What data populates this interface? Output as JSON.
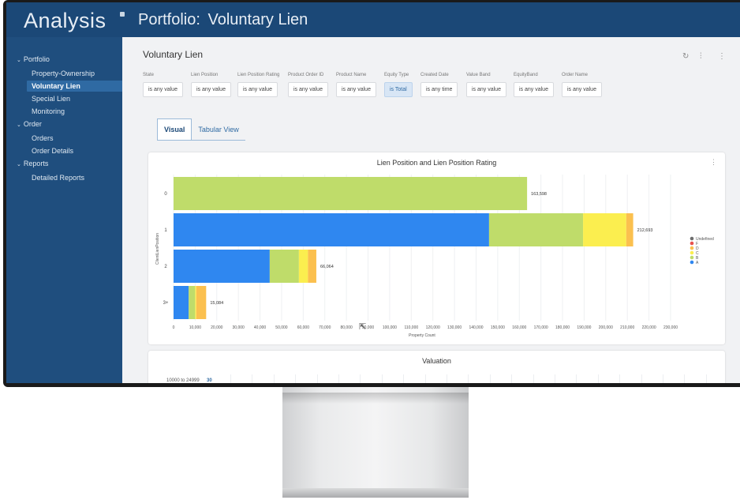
{
  "app": {
    "title": "Analysis"
  },
  "page": {
    "title_prefix": "Portfolio:",
    "title_name": "Voluntary Lien"
  },
  "sidebar": {
    "sections": [
      {
        "label": "Portfolio",
        "items": [
          {
            "label": "Property-Ownership",
            "active": false
          },
          {
            "label": "Voluntary Lien",
            "active": true
          },
          {
            "label": "Special Lien",
            "active": false
          },
          {
            "label": "Monitoring",
            "active": false
          }
        ]
      },
      {
        "label": "Order",
        "items": [
          {
            "label": "Orders",
            "active": false
          },
          {
            "label": "Order Details",
            "active": false
          }
        ]
      },
      {
        "label": "Reports",
        "items": [
          {
            "label": "Detailed Reports",
            "active": false
          }
        ]
      }
    ]
  },
  "report": {
    "title": "Voluntary Lien"
  },
  "toolbar_icons": [
    "refresh-icon",
    "filter-icon",
    "more-icon"
  ],
  "filters": [
    {
      "label": "State",
      "value": "is any value",
      "highlighted": false
    },
    {
      "label": "Lien Position",
      "value": "is any value",
      "highlighted": false
    },
    {
      "label": "Lien Position Rating",
      "value": "is any value",
      "highlighted": false
    },
    {
      "label": "Product Order ID",
      "value": "is any value",
      "highlighted": false
    },
    {
      "label": "Product Name",
      "value": "is any value",
      "highlighted": false
    },
    {
      "label": "Equity Type",
      "value": "is Total",
      "highlighted": true
    },
    {
      "label": "Created Date",
      "value": "is any time",
      "highlighted": false
    },
    {
      "label": "Value Band",
      "value": "is any value",
      "highlighted": false
    },
    {
      "label": "EquityBand",
      "value": "is any value",
      "highlighted": false
    },
    {
      "label": "Order Name",
      "value": "is any value",
      "highlighted": false
    }
  ],
  "tabs": [
    {
      "label": "Visual",
      "active": true
    },
    {
      "label": "Tabular View",
      "active": false
    }
  ],
  "colors": {
    "A": "#2f87f0",
    "B": "#bfdc6a",
    "C": "#fbee4f",
    "D": "#fbc04f",
    "F": "#e8514d",
    "Undefined": "#6e6e6e"
  },
  "chart_data": {
    "type": "bar",
    "orientation": "horizontal",
    "stacked": true,
    "title": "Lien Position and Lien Position Rating",
    "xlabel": "Property Count",
    "ylabel": "ClientLienPosition",
    "categories": [
      "0",
      "1",
      "2",
      "3+"
    ],
    "totals_labels": [
      "163,598",
      "212,693",
      "66,064",
      "15,084"
    ],
    "series": [
      {
        "name": "A",
        "color": "#2f87f0",
        "values": [
          0,
          146000,
          44500,
          7000
        ]
      },
      {
        "name": "B",
        "color": "#bfdc6a",
        "values": [
          163598,
          43500,
          13500,
          3000
        ]
      },
      {
        "name": "C",
        "color": "#fbee4f",
        "values": [
          0,
          20000,
          4200,
          500
        ]
      },
      {
        "name": "D",
        "color": "#fbc04f",
        "values": [
          0,
          3193,
          3864,
          4584
        ]
      },
      {
        "name": "F",
        "color": "#e8514d",
        "values": [
          0,
          0,
          0,
          0
        ]
      },
      {
        "name": "Undefined",
        "color": "#6e6e6e",
        "values": [
          0,
          0,
          0,
          0
        ]
      }
    ],
    "legend_order": [
      "Undefined",
      "F",
      "D",
      "C",
      "B",
      "A"
    ],
    "legend_position": "right",
    "xlim": [
      0,
      230000
    ],
    "xticks": [
      0,
      10000,
      20000,
      30000,
      40000,
      50000,
      60000,
      70000,
      80000,
      90000,
      100000,
      110000,
      120000,
      130000,
      140000,
      150000,
      160000,
      170000,
      180000,
      190000,
      200000,
      210000,
      220000,
      230000
    ],
    "xtick_labels": [
      "0",
      "10,000",
      "20,000",
      "30,000",
      "40,000",
      "50,000",
      "60,000",
      "70,000",
      "80,000",
      "90,000",
      "100,000",
      "110,000",
      "120,000",
      "130,000",
      "140,000",
      "150,000",
      "160,000",
      "170,000",
      "180,000",
      "190,000",
      "200,000",
      "210,000",
      "220,000",
      "230,000"
    ],
    "grid": true
  },
  "valuation": {
    "title": "Valuation",
    "rows": [
      {
        "label": "10000 to 24999",
        "value": "30"
      }
    ]
  }
}
